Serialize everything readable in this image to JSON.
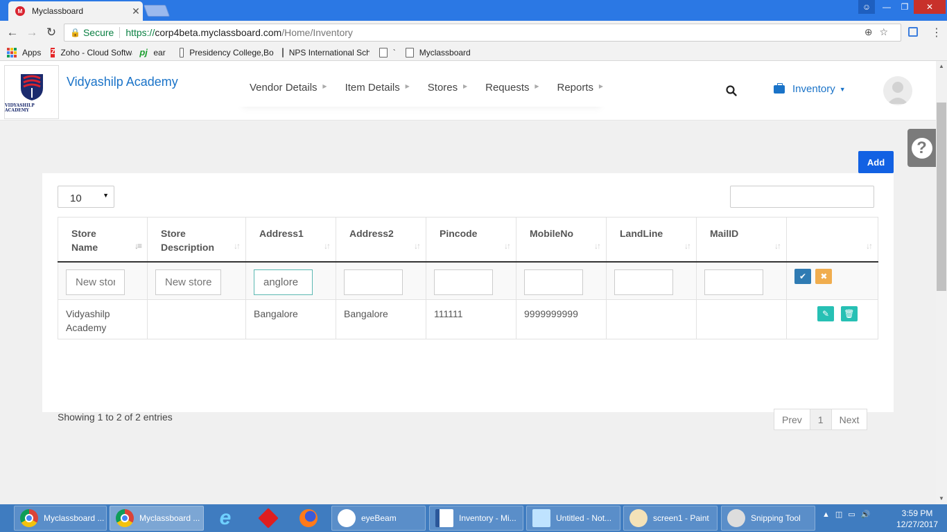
{
  "browser": {
    "tab_title": "Myclassboard",
    "tab_favicon_letter": "M",
    "secure_label": "Secure",
    "url_scheme": "https://",
    "url_host": "corp4beta.myclassboard.com",
    "url_path": "/Home/Inventory"
  },
  "bookmarks": {
    "apps": "Apps",
    "items": [
      "Zoho - Cloud Softwa",
      "ear",
      "Presidency College,Bo",
      "NPS International Sch",
      "`",
      "Myclassboard"
    ]
  },
  "app": {
    "logo_text": "VIDYASHILP ACADEMY",
    "school_name": "Vidyashilp Academy",
    "nav": [
      "Vendor Details",
      "Item Details",
      "Stores",
      "Requests",
      "Reports"
    ],
    "module_menu": "Inventory",
    "help_symbol": "?",
    "add_label": "Add",
    "page_length": "10",
    "columns": [
      {
        "line1": "Store",
        "line2": "Name"
      },
      {
        "line1": "Store",
        "line2": "Description"
      },
      {
        "line1": "Address1",
        "line2": ""
      },
      {
        "line1": "Address2",
        "line2": ""
      },
      {
        "line1": "Pincode",
        "line2": ""
      },
      {
        "line1": "MobileNo",
        "line2": ""
      },
      {
        "line1": "LandLine",
        "line2": ""
      },
      {
        "line1": "MailID",
        "line2": ""
      }
    ],
    "new_row": {
      "store_name_placeholder": "New store name",
      "store_desc_placeholder": "New store desc",
      "address1_value": "anglore"
    },
    "rows": [
      {
        "store_name": "Vidyashilp Academy",
        "store_description": "",
        "address1": "Bangalore",
        "address2": "Bangalore",
        "pincode": "111111",
        "mobile": "9999999999",
        "landline": "",
        "mail": ""
      }
    ],
    "info_text": "Showing 1 to 2 of 2 entries",
    "pager": {
      "prev": "Prev",
      "page": "1",
      "next": "Next"
    }
  },
  "taskbar": {
    "items": [
      "Myclassboard ...",
      "Myclassboard ...",
      "eyeBeam",
      "Inventory - Mi...",
      "Untitled - Not...",
      "screen1 - Paint",
      "Snipping Tool"
    ],
    "time": "3:59 PM",
    "date": "12/27/2017"
  },
  "colors": {
    "chrome_blue": "#2b78e4",
    "brand_blue": "#1a73c8",
    "add_button": "#1261e3",
    "action_teal": "#27c0b4",
    "cancel_orange": "#f0ad4e",
    "taskbar": "#3f7cc0"
  },
  "icons": [
    "search-icon",
    "briefcase-icon",
    "help-icon",
    "sort-icon",
    "check-icon",
    "close-icon",
    "pencil-icon",
    "trash-icon",
    "lock-icon",
    "star-icon",
    "zoom-icon"
  ]
}
